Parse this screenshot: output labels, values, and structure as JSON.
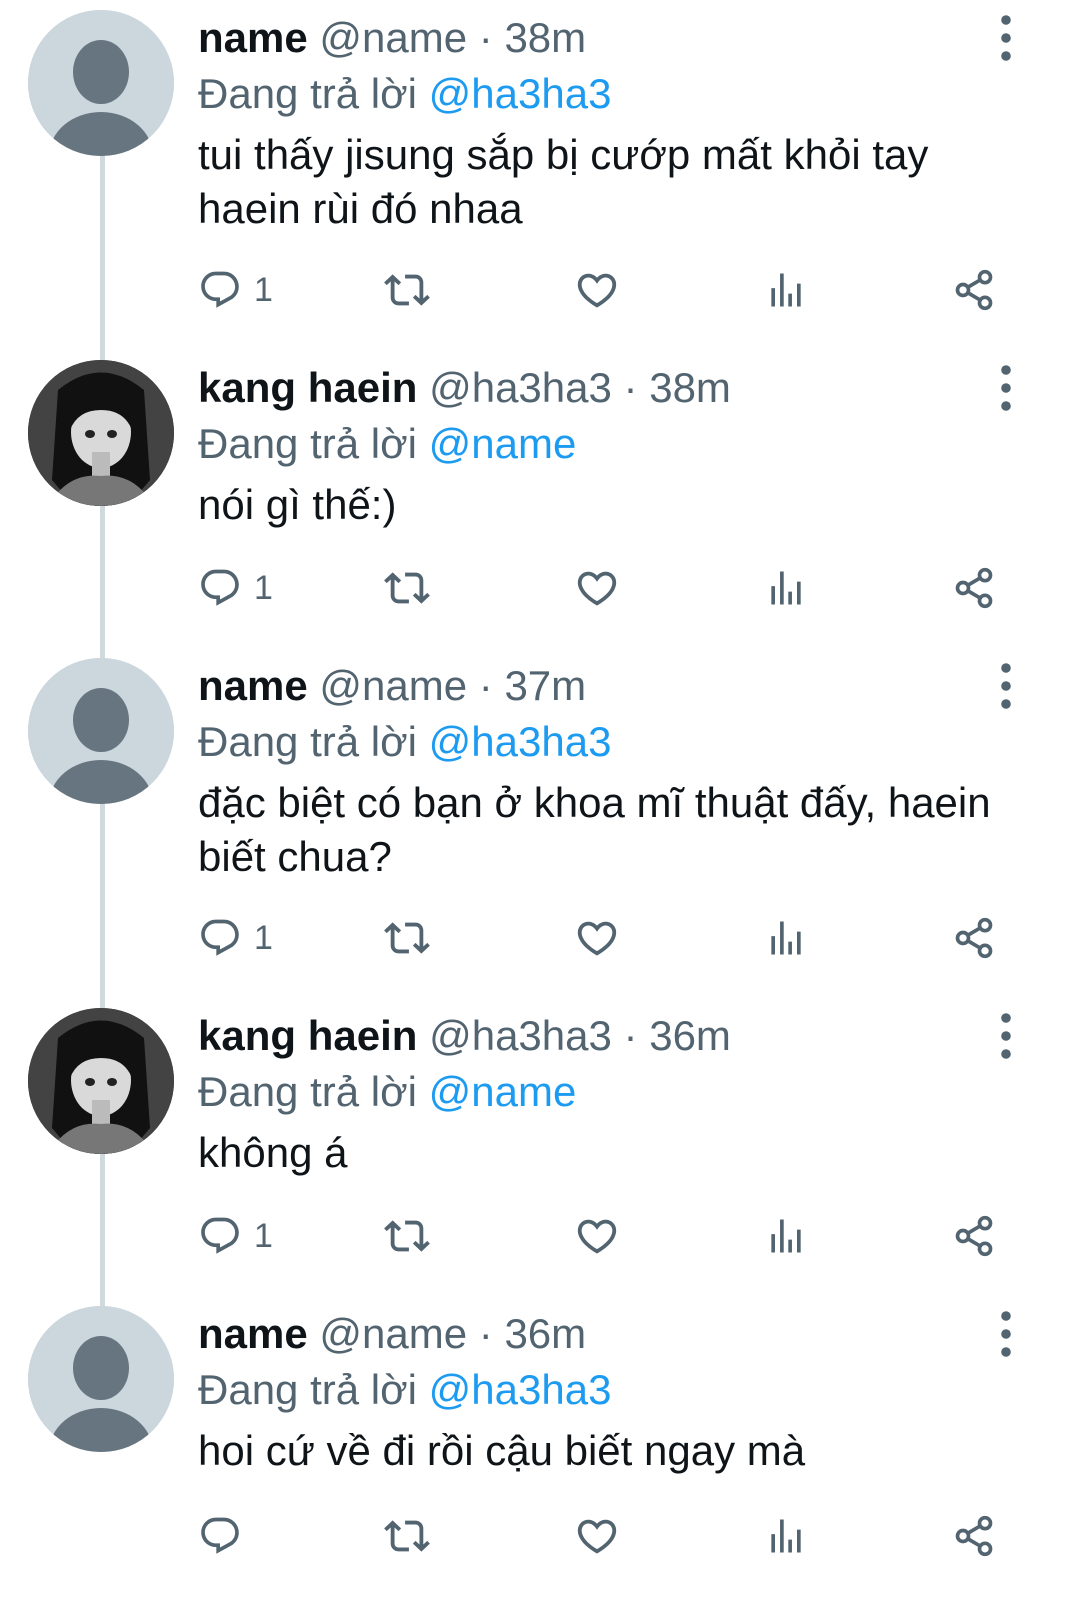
{
  "colors": {
    "mention": "#1d9bf0",
    "secondary_text": "#536471",
    "icon": "#536471",
    "thread_line": "#cfd9de"
  },
  "tweets": [
    {
      "display_name": "name",
      "handle": "@name",
      "separator": "·",
      "time": "38m",
      "reply_prefix": "Đang trả lời",
      "reply_to": "@ha3ha3",
      "text": "tui thấy jisung sắp bị cướp mất khỏi tay haein rùi đó nhaa",
      "reply_count": "1",
      "avatar": "default-avatar-icon"
    },
    {
      "display_name": "kang haein",
      "handle": "@ha3ha3",
      "separator": "·",
      "time": "38m",
      "reply_prefix": "Đang trả lời",
      "reply_to": "@name",
      "text": "nói gì thế:)",
      "reply_count": "1",
      "avatar": "anime-girl-avatar"
    },
    {
      "display_name": "name",
      "handle": "@name",
      "separator": "·",
      "time": "37m",
      "reply_prefix": "Đang trả lời",
      "reply_to": "@ha3ha3",
      "text": "đặc biệt có bạn ở khoa mĩ thuật đấy, haein biết chua?",
      "reply_count": "1",
      "avatar": "default-avatar-icon"
    },
    {
      "display_name": "kang haein",
      "handle": "@ha3ha3",
      "separator": "·",
      "time": "36m",
      "reply_prefix": "Đang trả lời",
      "reply_to": "@name",
      "text": "không á",
      "reply_count": "1",
      "avatar": "anime-girl-avatar"
    },
    {
      "display_name": "name",
      "handle": "@name",
      "separator": "·",
      "time": "36m",
      "reply_prefix": "Đang trả lời",
      "reply_to": "@ha3ha3",
      "text": "hoi cứ về đi rồi cậu biết ngay mà",
      "reply_count": "",
      "avatar": "default-avatar-icon"
    }
  ]
}
